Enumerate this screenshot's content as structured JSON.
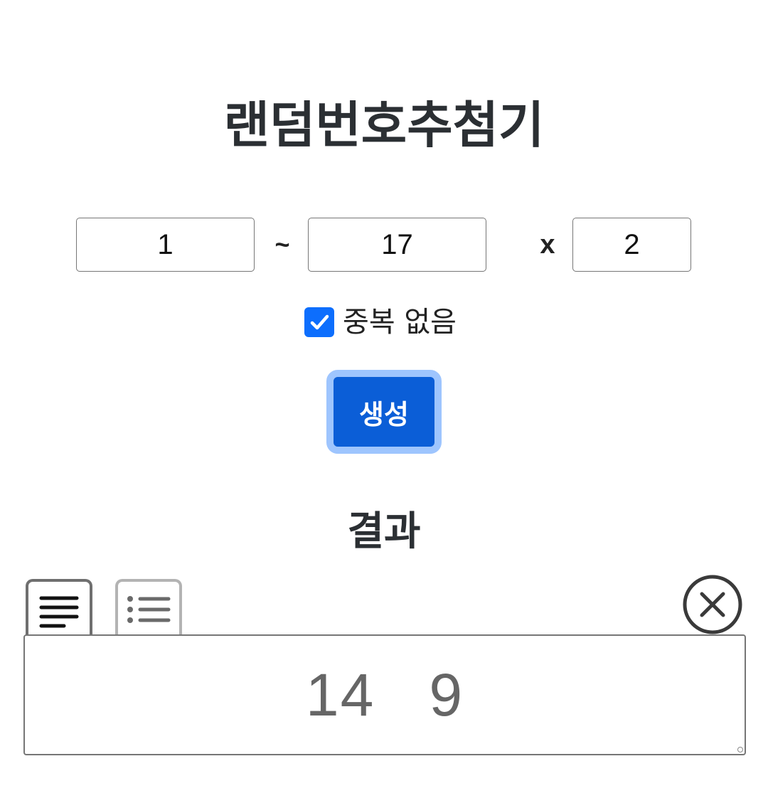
{
  "title": "랜덤번호추첨기",
  "range": {
    "min": "1",
    "separator": "~",
    "max": "17",
    "times_symbol": "x",
    "count": "2"
  },
  "options": {
    "no_duplicates_label": "중복 없음",
    "no_duplicates_checked": true
  },
  "actions": {
    "generate_label": "생성"
  },
  "result": {
    "heading": "결과",
    "view_modes": [
      "text-view-icon",
      "list-view-icon"
    ],
    "active_view": "text",
    "output": "14   9"
  },
  "colors": {
    "primary": "#0d6efd",
    "button_bg": "#0b5ed7",
    "button_focus_ring": "#9ec5fe",
    "text": "#2b2f33",
    "result_text": "#666666"
  }
}
